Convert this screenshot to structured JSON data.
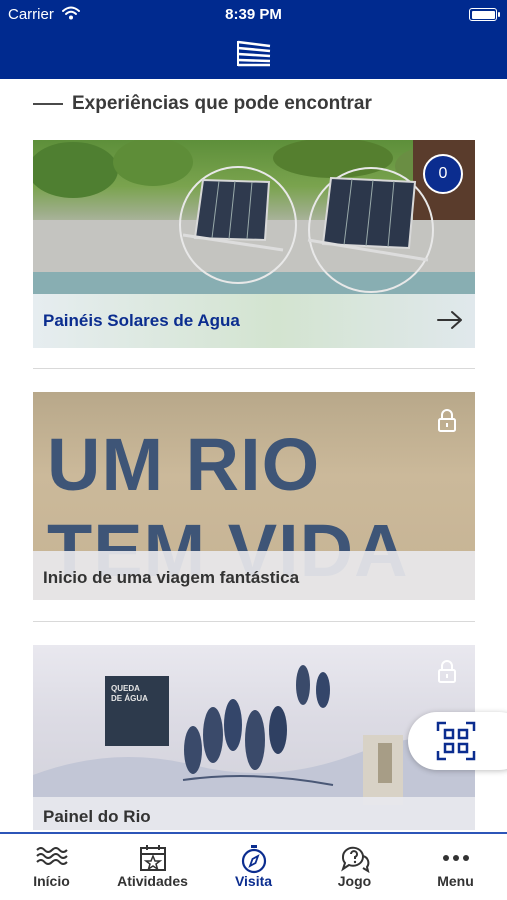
{
  "status_bar": {
    "carrier": "Carrier",
    "time": "8:39 PM",
    "icons": [
      "wifi-icon",
      "battery-icon"
    ]
  },
  "nav_bar": {
    "logo_icon": "stacked-lines-logo"
  },
  "section": {
    "title": "Experiências que pode encontrar"
  },
  "cards": [
    {
      "title": "Painéis Solares de Agua",
      "badge": "0",
      "action_icon": "arrow-right-icon",
      "image": "solar-panels-photo",
      "locked": false
    },
    {
      "title": "Inicio de uma viagem fantástica",
      "image_text": "UM RIO\nTEM VIDA",
      "action_icon": "lock-icon",
      "image": "wall-lettering-photo",
      "locked": true
    },
    {
      "title": "Painel do Rio",
      "image_sign_text": "QUEDA\nDE ÁGUA",
      "action_icon": "lock-icon",
      "image": "river-panel-photo",
      "locked": true
    }
  ],
  "floating_button": {
    "icon": "qr-code-icon"
  },
  "tab_bar": {
    "active": "Visita",
    "tabs": [
      {
        "label": "Início",
        "icon": "waves-icon"
      },
      {
        "label": "Atividades",
        "icon": "calendar-star-icon"
      },
      {
        "label": "Visita",
        "icon": "compass-icon"
      },
      {
        "label": "Jogo",
        "icon": "chat-question-icon"
      },
      {
        "label": "Menu",
        "icon": "more-dots-icon"
      }
    ]
  },
  "colors": {
    "brand_blue": "#002a8f",
    "accent_blue": "#0b2d8f",
    "text_dark": "#333333"
  }
}
